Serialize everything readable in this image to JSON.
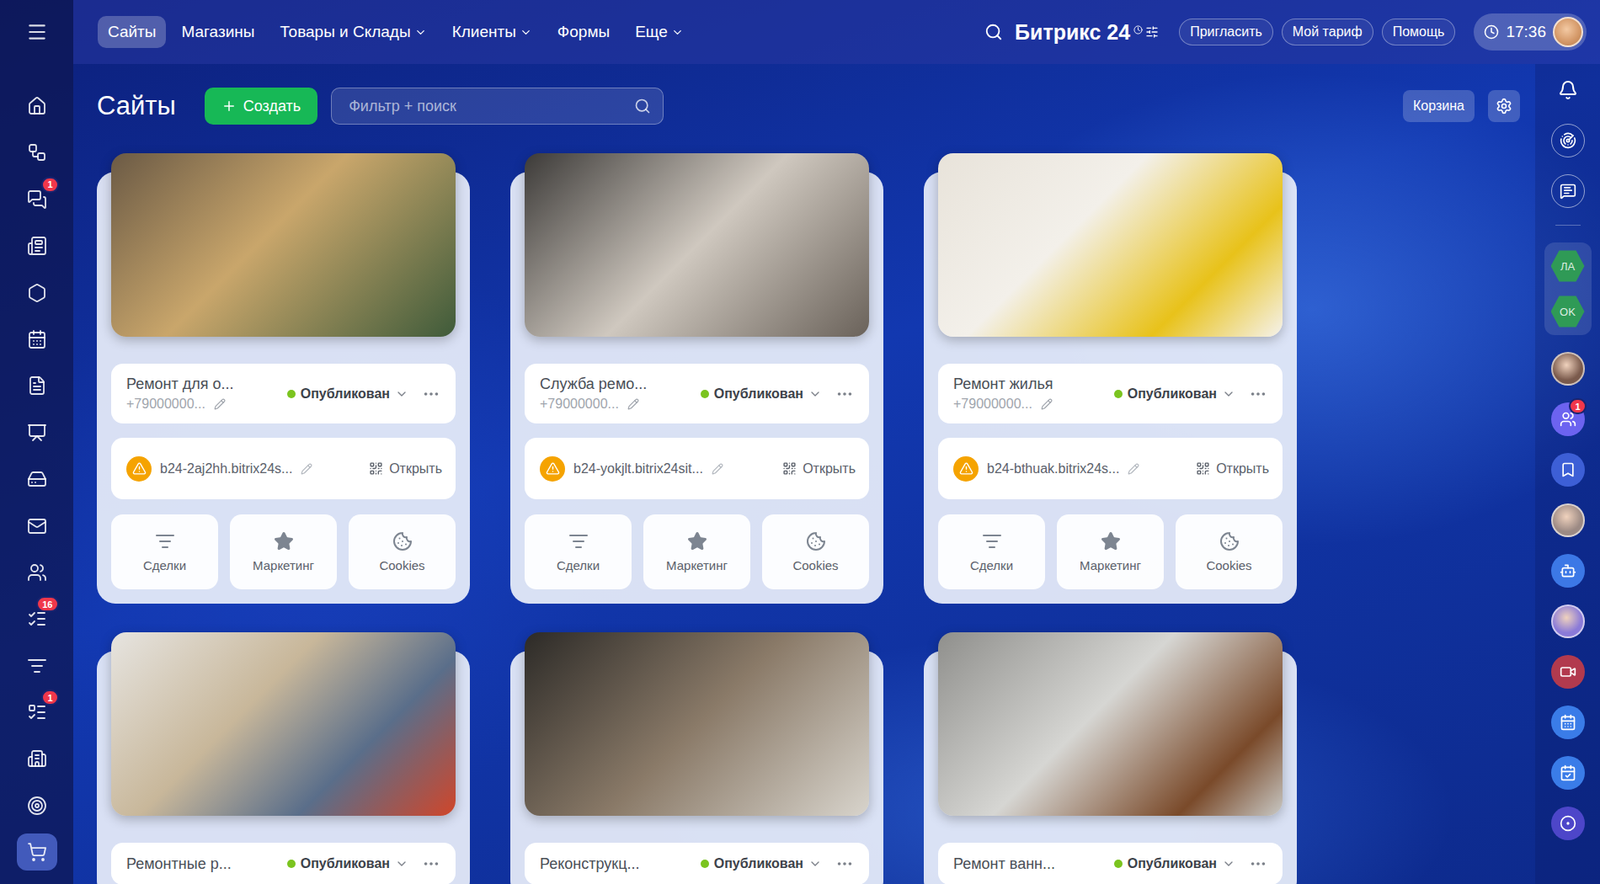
{
  "topbar": {
    "nav": [
      {
        "label": "Сайты",
        "selected": true,
        "has_menu": false
      },
      {
        "label": "Магазины",
        "selected": false,
        "has_menu": false
      },
      {
        "label": "Товары и Склады",
        "selected": false,
        "has_menu": true
      },
      {
        "label": "Клиенты",
        "selected": false,
        "has_menu": true
      },
      {
        "label": "Формы",
        "selected": false,
        "has_menu": false
      },
      {
        "label": "Еще",
        "selected": false,
        "has_menu": true
      }
    ],
    "logo": "Битрикс 24",
    "buttons": [
      "Пригласить",
      "Мой тариф",
      "Помощь"
    ],
    "time": "17:36"
  },
  "left_sidebar": {
    "items": [
      {
        "selected": false
      },
      {
        "selected": false
      },
      {
        "selected": false,
        "badge": "1"
      },
      {
        "selected": false
      },
      {
        "selected": false
      },
      {
        "selected": false
      },
      {
        "selected": false
      },
      {
        "selected": false
      },
      {
        "selected": false
      },
      {
        "selected": false
      },
      {
        "selected": false
      },
      {
        "selected": false,
        "badge": "16"
      },
      {
        "selected": false
      },
      {
        "selected": false,
        "badge": "1"
      },
      {
        "selected": false
      },
      {
        "selected": false
      },
      {
        "selected": true
      }
    ]
  },
  "page": {
    "title": "Сайты",
    "create_button": "Создать",
    "search_placeholder": "Фильтр + поиск",
    "trash_button": "Корзина"
  },
  "cards": [
    {
      "title": "Ремонт для о...",
      "phone": "+79000000...",
      "status": "Опубликован",
      "published": true,
      "domain": "b24-2aj2hh.bitrix24s...",
      "domain_warning": true,
      "open_label": "Открыть",
      "actions": [
        "Сделки",
        "Маркетинг",
        "Cookies"
      ]
    },
    {
      "title": "Служба ремо...",
      "phone": "+79000000...",
      "status": "Опубликован",
      "published": true,
      "domain": "b24-yokjlt.bitrix24sit...",
      "domain_warning": true,
      "open_label": "Открыть",
      "actions": [
        "Сделки",
        "Маркетинг",
        "Cookies"
      ]
    },
    {
      "title": "Ремонт жилья",
      "phone": "+79000000...",
      "status": "Опубликован",
      "published": true,
      "domain": "b24-bthuak.bitrix24s...",
      "domain_warning": true,
      "open_label": "Открыть",
      "actions": [
        "Сделки",
        "Маркетинг",
        "Cookies"
      ]
    },
    {
      "title": "Ремонтные р...",
      "status": "Опубликован",
      "published": true
    },
    {
      "title": "Реконструкц...",
      "status": "Опубликован",
      "published": true
    },
    {
      "title": "Ремонт ванн...",
      "status": "Опубликован",
      "published": true
    }
  ],
  "right_sidebar": {
    "items": [
      {
        "kind": "plain"
      },
      {
        "kind": "outline"
      },
      {
        "kind": "outline"
      },
      {
        "kind": "divider"
      },
      {
        "kind": "group",
        "labels": [
          "ЛА",
          "OK"
        ]
      },
      {
        "kind": "avatar",
        "color": "#7a5a4c"
      },
      {
        "kind": "filled",
        "color": "#6c63f0",
        "badge": "1"
      },
      {
        "kind": "filled",
        "color": "#3d5fd6"
      },
      {
        "kind": "avatar",
        "color": "#9c8a84"
      },
      {
        "kind": "filled",
        "color": "#3c78e6"
      },
      {
        "kind": "avatar",
        "color": "#8a7ad8"
      },
      {
        "kind": "filled",
        "color": "#b23a4e"
      },
      {
        "kind": "filled",
        "color": "#3a7ce8"
      },
      {
        "kind": "filled",
        "color": "#3a7ce8"
      },
      {
        "kind": "filled",
        "color": "#4d46c9"
      }
    ]
  }
}
